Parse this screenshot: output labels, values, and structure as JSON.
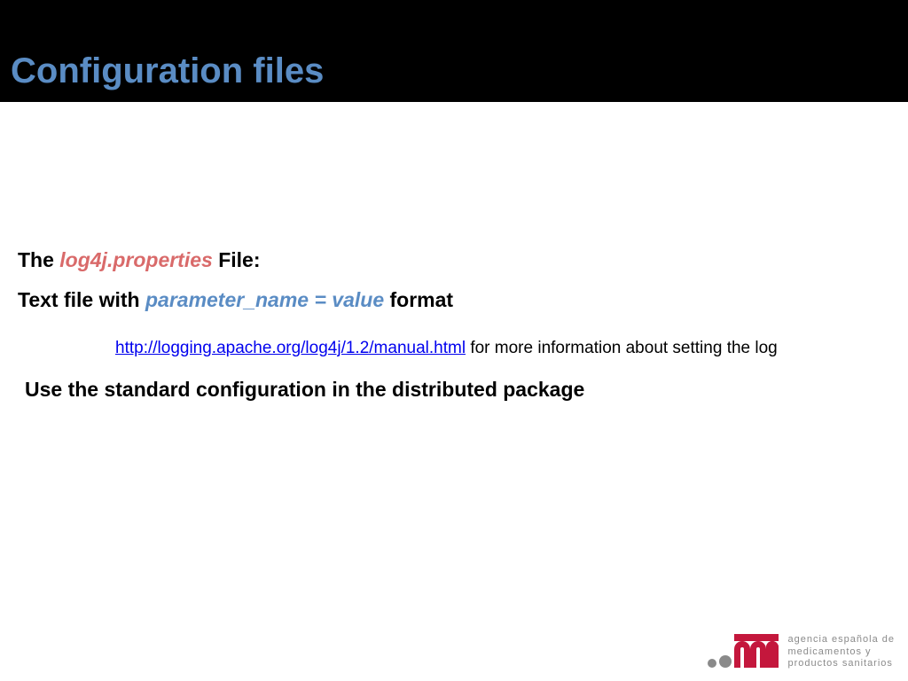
{
  "header": {
    "title": "Configuration files"
  },
  "body": {
    "line1_pre": "The ",
    "line1_em": "log4j.properties",
    "line1_post": " File:",
    "line2_pre": "Text file with ",
    "line2_em": "parameter_name = value",
    "line2_post": " format",
    "link_text": "http://logging.apache.org/log4j/1.2/manual.html",
    "link_after": " for more information about setting the log",
    "line4": "Use the standard configuration in the distributed package"
  },
  "footer": {
    "line1": "agencia española de",
    "line2": "medicamentos y",
    "line3": "productos sanitarios"
  }
}
